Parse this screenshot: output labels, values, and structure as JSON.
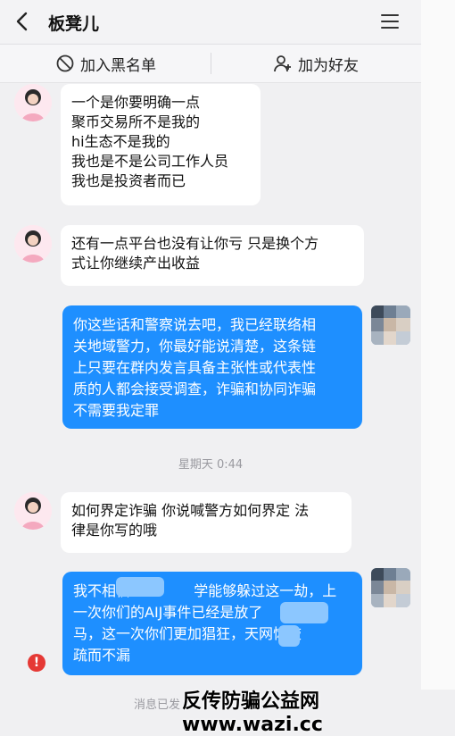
{
  "header": {
    "title": "板凳儿",
    "back_icon": "chevron-left-icon",
    "menu_icon": "hamburger-icon"
  },
  "actions": {
    "block": "加入黑名单",
    "add_friend": "加为好友"
  },
  "messages": [
    {
      "side": "in",
      "lines": [
        "一个是你要明确一点",
        "聚币交易所不是我的",
        "hi生态不是我的",
        "我也是不是公司工作人员",
        "我也是投资者而已"
      ]
    },
    {
      "side": "in",
      "lines": [
        "还有一点平台也没有让你亏 只是换个方",
        "式让你继续产出收益"
      ]
    },
    {
      "side": "out",
      "lines": [
        "你这些话和警察说去吧，我已经联络相",
        "关地域警力，你最好能说清楚，这条链",
        "上只要在群内发言具备主张性或代表性",
        "质的人都会接受调查，诈骗和协同诈骗",
        "不需要我定罪"
      ]
    },
    {
      "side": "in",
      "lines": [
        "如何界定诈骗 你说喊警方如何界定 法",
        "律是你写的哦"
      ]
    },
    {
      "side": "out",
      "lines": [
        "我不相信              学能够躲过这一劫，上",
        "一次你们的AIJ事件已经是放了           一",
        "马，这一次你们更加猖狂，天网恢恢",
        "疏而不漏"
      ]
    }
  ],
  "timestamp": "星期天 0:44",
  "footer_note": "消息已发",
  "watermark": "反传防骗公益网 www.wazi.cc",
  "colors": {
    "outgoing_bubble": "#1e8fff",
    "incoming_bubble": "#ffffff",
    "background": "#f0f0f2",
    "error": "#e53935"
  }
}
